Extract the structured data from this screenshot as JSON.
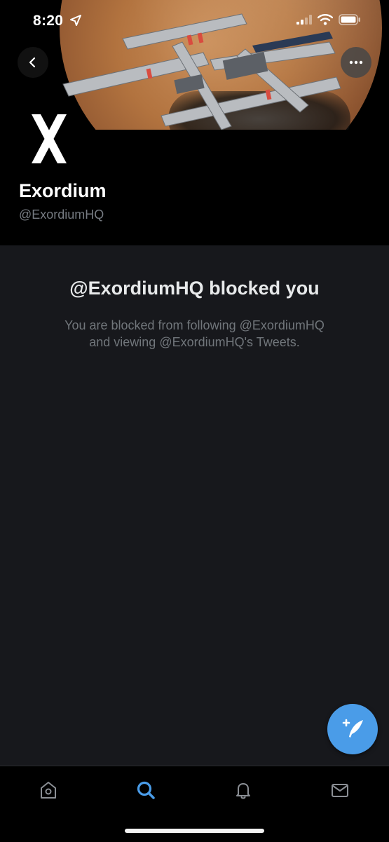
{
  "status_bar": {
    "time": "8:20",
    "icons": [
      "location-arrow-icon",
      "cellular-signal-icon",
      "wifi-icon",
      "battery-icon"
    ]
  },
  "banner": {
    "description": "space-station-banner",
    "back_icon": "chevron-left-icon",
    "more_icon": "more-horizontal-icon"
  },
  "profile": {
    "avatar_letter": "X",
    "name": "Exordium",
    "handle": "@ExordiumHQ"
  },
  "blocked": {
    "title": "@ExordiumHQ blocked you",
    "description_line1": "You are blocked from following @ExordiumHQ",
    "description_line2": "and viewing @ExordiumHQ's Tweets."
  },
  "compose": {
    "icon": "compose-feather-icon"
  },
  "tabs": [
    {
      "name": "home",
      "icon": "home-icon",
      "active": false
    },
    {
      "name": "search",
      "icon": "search-icon",
      "active": true
    },
    {
      "name": "notifications",
      "icon": "bell-icon",
      "active": false
    },
    {
      "name": "messages",
      "icon": "mail-icon",
      "active": false
    }
  ],
  "colors": {
    "accent": "#4a9ce8",
    "background": "#17181c",
    "header_background": "#000000",
    "secondary_text": "#71767b"
  }
}
